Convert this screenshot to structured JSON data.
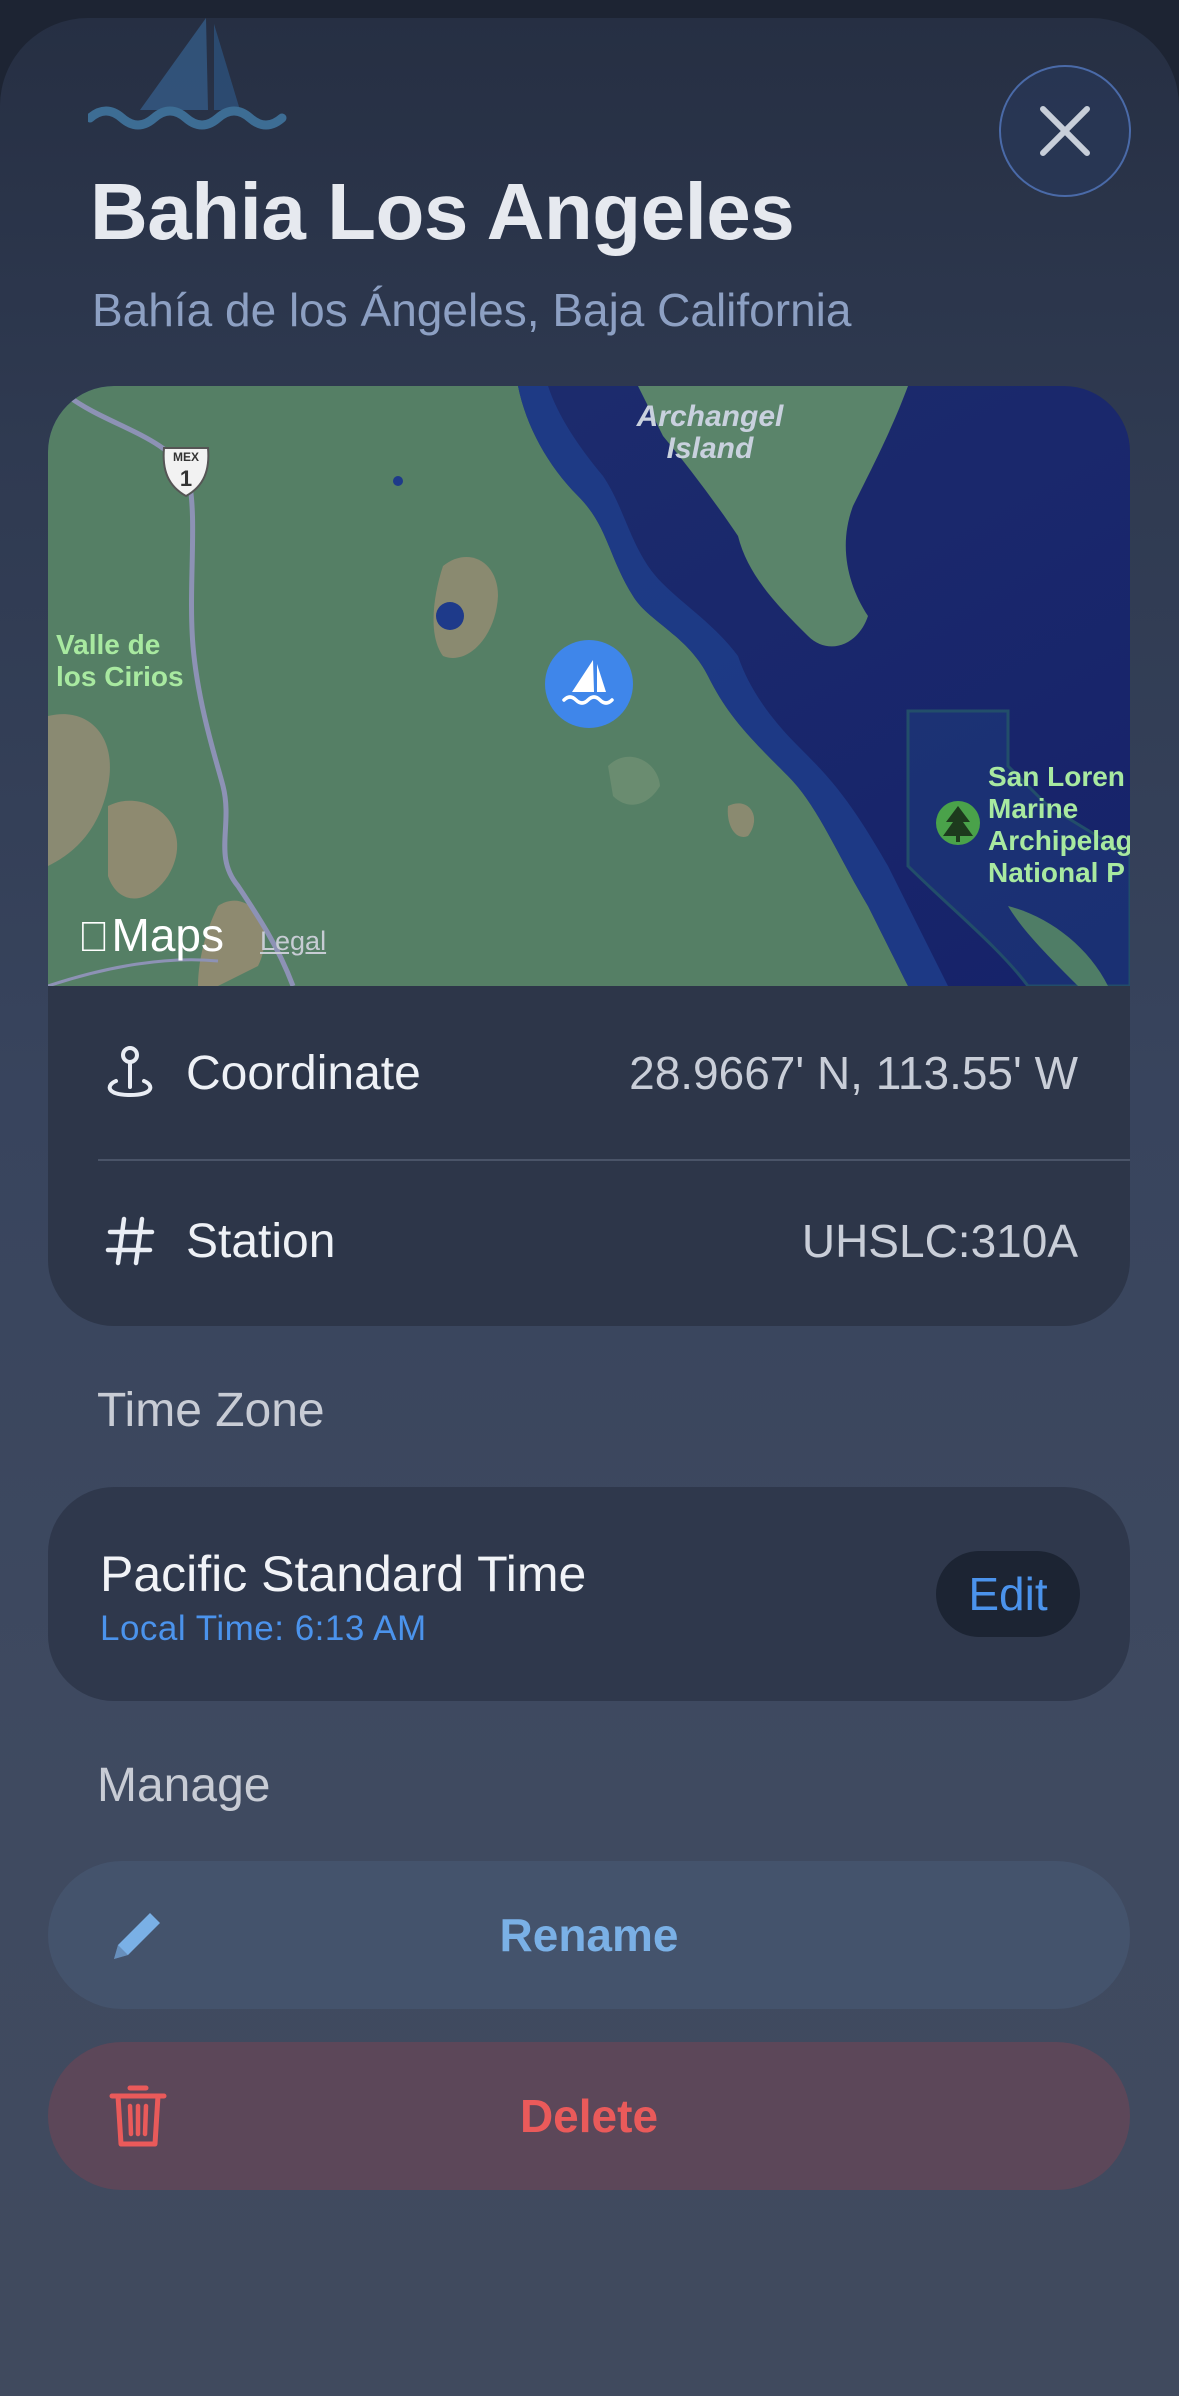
{
  "header": {
    "title": "Bahia Los Angeles",
    "subtitle": "Bahía de los Ángeles, Baja California"
  },
  "map": {
    "labels": {
      "highway": "MEX",
      "highway_number": "1",
      "island": "Archangel Island",
      "island_line1": "Archangel",
      "island_line2": "Island",
      "valley_line1": "Valle de",
      "valley_line2": "los Cirios",
      "park_line1": "San Loren",
      "park_line2": "Marine",
      "park_line3": "Archipelag",
      "park_line4": "National P"
    },
    "brand": "Maps",
    "legal": "Legal"
  },
  "details": {
    "coordinate_label": "Coordinate",
    "coordinate_value": "28.9667' N, 113.55' W",
    "station_label": "Station",
    "station_value": "UHSLC:310A"
  },
  "timezone": {
    "section_label": "Time Zone",
    "name": "Pacific Standard Time",
    "local_time": "Local Time: 6:13 AM",
    "edit_label": "Edit"
  },
  "manage": {
    "section_label": "Manage",
    "rename_label": "Rename",
    "delete_label": "Delete"
  },
  "colors": {
    "accent_blue": "#4b93ec",
    "destructive_red": "#ea5a5a",
    "rename_text": "#7ab0e6"
  },
  "icons": {
    "logo": "sailboat-waves-icon",
    "close": "close-icon",
    "coordinate": "map-pin-icon",
    "station": "number-sign-icon",
    "rename": "pencil-icon",
    "delete": "trash-icon",
    "map_marker": "sailboat-marker-icon",
    "park": "tree-icon"
  }
}
